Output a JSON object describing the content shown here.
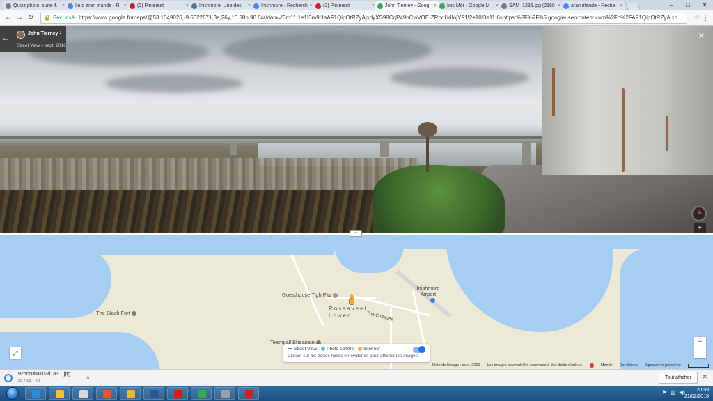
{
  "browser": {
    "tabs": [
      {
        "title": "Quizz photo, suite 4.",
        "color": "#7a7a7a"
      },
      {
        "title": "île d aran irlande - R",
        "color": "#4285f4"
      },
      {
        "title": "(2) Pinterest",
        "color": "#cb2027"
      },
      {
        "title": "Inishmore: Une des",
        "color": "#5b6f9c"
      },
      {
        "title": "Inishmore - Recherch",
        "color": "#4285f4"
      },
      {
        "title": "(2) Pinterest",
        "color": "#cb2027"
      },
      {
        "title": "John Tierney - Goog",
        "color": "#34a853"
      },
      {
        "title": "Inis Mór - Google M",
        "color": "#34a853"
      },
      {
        "title": "SAM_1236.jpg (2160",
        "color": "#7a7a7a"
      },
      {
        "title": "aran irlande - Reche",
        "color": "#4285f4"
      }
    ],
    "active_tab_index": 6,
    "window_controls": {
      "minimize": "–",
      "maximize": "□",
      "close": "✕"
    },
    "address": {
      "secure_label": "Sécurisé",
      "url": "https://www.google.fr/maps/@53.1049026,-9.6622671,3a,26y,16.88h,90.64t/data=!3m11!1e1!3m9!1sAF1QipOtRZyAjxdyXS98CqP49bCwVOE-ZRpdHdIojYF1!2e10!3e11!6shttps:%2F%2Flh5.googleusercontent.com%2Fp%2FAF1QipOtRZyAjxdyXS98CqP49bCwVOE-ZR..."
    }
  },
  "streetview": {
    "author": "John Tierney",
    "date": "Street View – sept. 2016"
  },
  "map": {
    "labels": {
      "guesthouse": "Guesthouse Tigh Fitz",
      "town": "Rossaveel Lower",
      "airport": "Inishmore Airport",
      "cottages": "The Cottages",
      "black_fort": "The Black Fort",
      "teampall": "Teampall Bheanain"
    },
    "layers": {
      "street_view": "Street View",
      "photosphere": "Photo-sphère",
      "interior": "Intérieur",
      "hint": "Cliquer sur les zones mises en évidence pour afficher les images",
      "colors": {
        "street_view": "#3b7ddd",
        "photosphere": "#5fb4e6",
        "interior": "#f4a73a"
      }
    },
    "footer": {
      "image_date": "Date de l'image : sept. 2016",
      "rights": "Les images peuvent être soumises à des droits d'auteur.",
      "world": "Monde",
      "terms": "Conditions",
      "report": "Signaler un problème"
    }
  },
  "downloads": {
    "file_name": "92bc60ba103d183....jpg",
    "file_size": "55,7/55,7 Ko",
    "show_all": "Tout afficher"
  },
  "taskbar": {
    "time": "20:59",
    "date": "21/02/2018",
    "apps": [
      {
        "name": "ie",
        "color": "#2b8cd6"
      },
      {
        "name": "explorer",
        "color": "#f0c040"
      },
      {
        "name": "notepad",
        "color": "#d8d8d8"
      },
      {
        "name": "media",
        "color": "#e0582c"
      },
      {
        "name": "folder",
        "color": "#e8b540"
      },
      {
        "name": "word",
        "color": "#2b5797"
      },
      {
        "name": "acrobat",
        "color": "#d11f1f"
      },
      {
        "name": "chrome",
        "color": "#34a853"
      },
      {
        "name": "disk",
        "color": "#9aa0a6"
      },
      {
        "name": "antivirus",
        "color": "#cc2222"
      }
    ]
  }
}
